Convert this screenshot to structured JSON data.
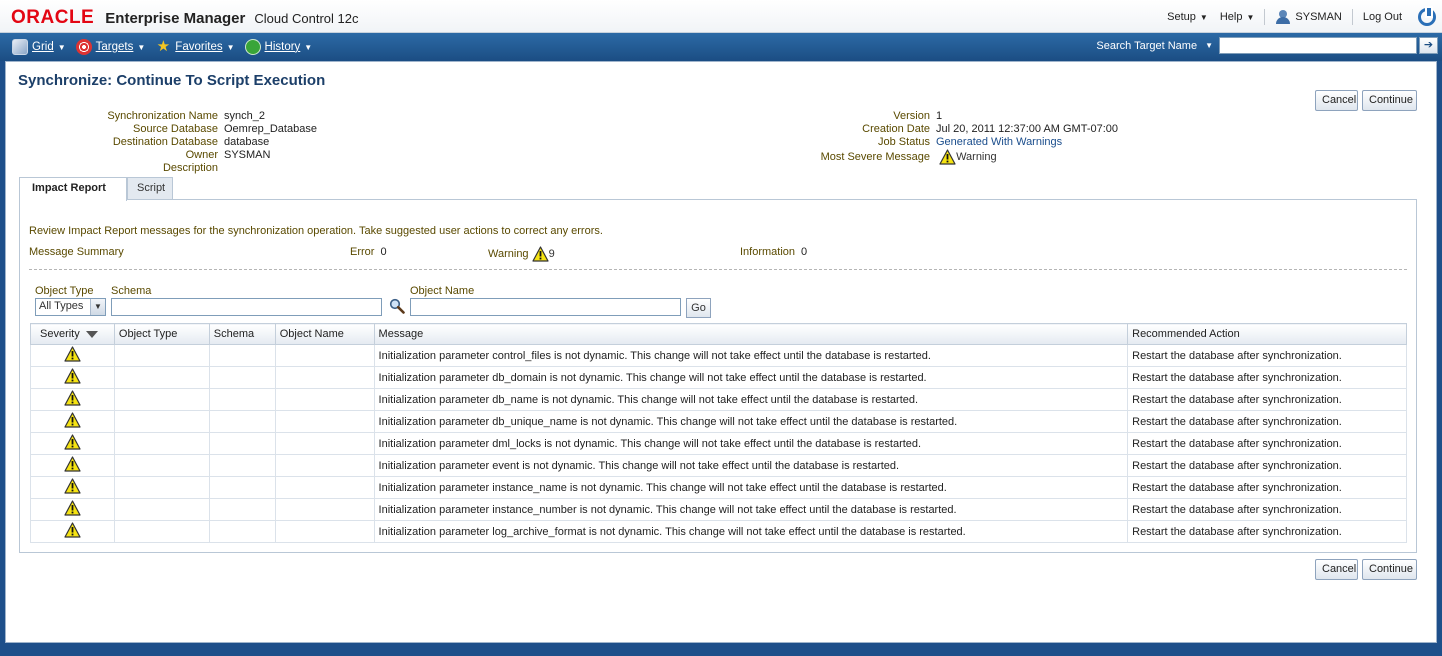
{
  "brand": {
    "oracle": "ORACLE",
    "product": "Enterprise Manager",
    "edition": "Cloud Control 12c"
  },
  "toplinks": {
    "setup": "Setup",
    "help": "Help",
    "user": "SYSMAN",
    "logout": "Log Out"
  },
  "nav": {
    "items": [
      {
        "label": "Grid",
        "icon": "grid-icon"
      },
      {
        "label": "Targets",
        "icon": "targets-icon"
      },
      {
        "label": "Favorites",
        "icon": "star-icon"
      },
      {
        "label": "History",
        "icon": "history-icon"
      }
    ],
    "search_label": "Search Target Name",
    "search_value": ""
  },
  "page": {
    "title": "Synchronize: Continue To Script Execution",
    "cancel": "Cancel",
    "continue": "Continue"
  },
  "details_left": [
    {
      "key": "Synchronization Name",
      "value": "synch_2"
    },
    {
      "key": "Source Database",
      "value": "Oemrep_Database"
    },
    {
      "key": "Destination Database",
      "value": "database"
    },
    {
      "key": "Owner",
      "value": "SYSMAN"
    },
    {
      "key": "Description",
      "value": ""
    }
  ],
  "details_right": [
    {
      "key": "Version",
      "value": "1"
    },
    {
      "key": "Creation Date",
      "value": "Jul 20, 2011 12:37:00 AM GMT-07:00"
    },
    {
      "key": "Job Status",
      "value": "Generated With Warnings"
    },
    {
      "key": "Most Severe Message",
      "value": "Warning"
    }
  ],
  "tabs": {
    "impact": "Impact Report",
    "script": "Script"
  },
  "impact": {
    "instruction": "Review Impact Report messages for the synchronization operation. Take suggested user actions to correct any errors.",
    "summary_label": "Message Summary",
    "error_label": "Error",
    "error_count": "0",
    "warning_label": "Warning",
    "warning_count": "9",
    "info_label": "Information",
    "info_count": "0"
  },
  "filters": {
    "object_type_label": "Object Type",
    "object_type_value": "All Types",
    "schema_label": "Schema",
    "schema_value": "",
    "object_name_label": "Object Name",
    "object_name_value": "",
    "go": "Go"
  },
  "table": {
    "headers": [
      "Severity",
      "Object Type",
      "Schema",
      "Object Name",
      "Message",
      "Recommended Action"
    ],
    "rows": [
      {
        "message": "Initialization parameter control_files is not dynamic. This change will not take effect until the database is restarted.",
        "action": "Restart the database after synchronization."
      },
      {
        "message": "Initialization parameter db_domain is not dynamic. This change will not take effect until the database is restarted.",
        "action": "Restart the database after synchronization."
      },
      {
        "message": "Initialization parameter db_name is not dynamic. This change will not take effect until the database is restarted.",
        "action": "Restart the database after synchronization."
      },
      {
        "message": "Initialization parameter db_unique_name is not dynamic. This change will not take effect until the database is restarted.",
        "action": "Restart the database after synchronization."
      },
      {
        "message": "Initialization parameter dml_locks is not dynamic. This change will not take effect until the database is restarted.",
        "action": "Restart the database after synchronization."
      },
      {
        "message": "Initialization parameter event is not dynamic. This change will not take effect until the database is restarted.",
        "action": "Restart the database after synchronization."
      },
      {
        "message": "Initialization parameter instance_name is not dynamic. This change will not take effect until the database is restarted.",
        "action": "Restart the database after synchronization."
      },
      {
        "message": "Initialization parameter instance_number is not dynamic. This change will not take effect until the database is restarted.",
        "action": "Restart the database after synchronization."
      },
      {
        "message": "Initialization parameter log_archive_format is not dynamic. This change will not take effect until the database is restarted.",
        "action": "Restart the database after synchronization."
      }
    ]
  },
  "colors": {
    "accent": "#1c3f69",
    "nav": "#1b4d83",
    "label": "#5a4a00",
    "warning": "#f5e312"
  }
}
